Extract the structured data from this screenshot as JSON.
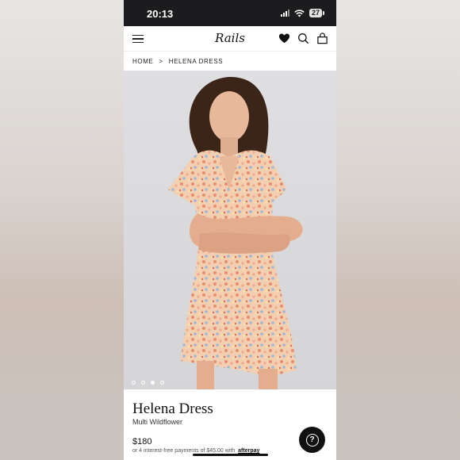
{
  "status_bar": {
    "time": "20:13",
    "battery": "27"
  },
  "header": {
    "logo": "Rails",
    "icons": [
      "menu-icon",
      "heart-icon",
      "search-icon",
      "bag-icon"
    ]
  },
  "breadcrumb": {
    "home": "HOME",
    "separator": ">",
    "current": "HELENA DRESS"
  },
  "gallery": {
    "image_count": 4,
    "active_index": 2
  },
  "product": {
    "name": "Helena Dress",
    "color": "Multi Wildflower",
    "price": "$180",
    "installments": "or 4 interest-free payments of $45.00 with",
    "installments_brand": "afterpay"
  },
  "colors": {
    "status_bar": "#1c1c1e",
    "dress_base": "#f1c4a4",
    "hair": "#3b2418",
    "help_button": "#111111"
  }
}
